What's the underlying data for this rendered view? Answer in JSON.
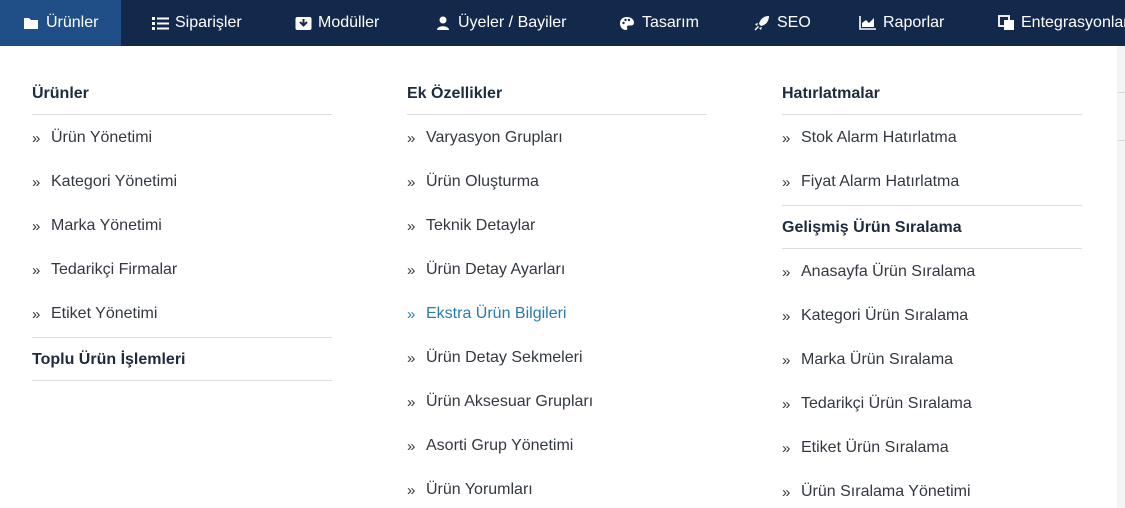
{
  "topnav": {
    "items": [
      {
        "label": "Ürünler",
        "icon": "folder-icon"
      },
      {
        "label": "Siparişler",
        "icon": "list-icon"
      },
      {
        "label": "Modüller",
        "icon": "box-icon"
      },
      {
        "label": "Üyeler / Bayiler",
        "icon": "user-icon"
      },
      {
        "label": "Tasarım",
        "icon": "palette-icon"
      },
      {
        "label": "SEO",
        "icon": "rocket-icon"
      },
      {
        "label": "Raporlar",
        "icon": "chart-icon"
      },
      {
        "label": "Entegrasyonlar",
        "icon": "copy-icon"
      }
    ],
    "active_index": 0,
    "colors": {
      "bar": "#13294b",
      "active": "#1f4f86"
    }
  },
  "menu": {
    "col1": {
      "heading": "Ürünler",
      "items": [
        "Ürün Yönetimi",
        "Kategori Yönetimi",
        "Marka Yönetimi",
        "Tedarikçi Firmalar",
        "Etiket Yönetimi"
      ],
      "heading2": "Toplu Ürün İşlemleri"
    },
    "col2": {
      "heading": "Ek Özellikler",
      "items": [
        "Varyasyon Grupları",
        "Ürün Oluşturma",
        "Teknik Detaylar",
        "Ürün Detay Ayarları",
        "Ekstra Ürün Bilgileri",
        "Ürün Detay Sekmeleri",
        "Ürün Aksesuar Grupları",
        "Asorti Grup Yönetimi",
        "Ürün Yorumları"
      ],
      "highlighted_index": 4
    },
    "col3": {
      "heading": "Hatırlatmalar",
      "items": [
        "Stok Alarm Hatırlatma",
        "Fiyat Alarm Hatırlatma"
      ],
      "heading2": "Gelişmiş Ürün Sıralama",
      "items2": [
        "Anasayfa Ürün Sıralama",
        "Kategori Ürün Sıralama",
        "Marka Ürün Sıralama",
        "Tedarikçi Ürün Sıralama",
        "Etiket Ürün Sıralama",
        "Ürün Sıralama Yönetimi"
      ]
    },
    "chevron_glyph": "»",
    "highlight_color": "#2a7ab0"
  }
}
